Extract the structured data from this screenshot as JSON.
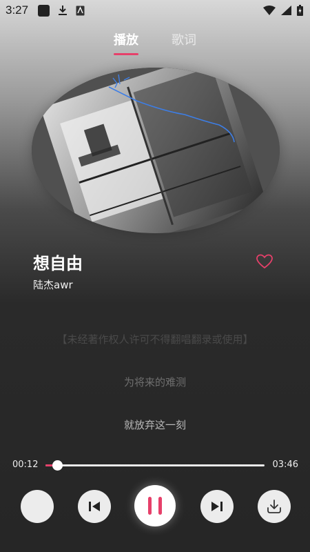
{
  "status_bar": {
    "time": "3:27"
  },
  "tabs": [
    {
      "label": "播放"
    },
    {
      "label": "歌词"
    }
  ],
  "song": {
    "title": "想自由",
    "artist": "陆杰awr"
  },
  "lyrics": [
    "【未经著作权人许可不得翻唱翻录或使用】",
    "为将来的难测",
    "就放弃这一刻"
  ],
  "progress": {
    "current": "00:12",
    "total": "03:46",
    "fraction": 0.053
  },
  "colors": {
    "accent": "#e6406a"
  },
  "controls": {
    "left": "blank-circle",
    "prev": "skip-previous-icon",
    "play": "pause-icon",
    "next": "skip-next-icon",
    "download": "download-icon"
  }
}
